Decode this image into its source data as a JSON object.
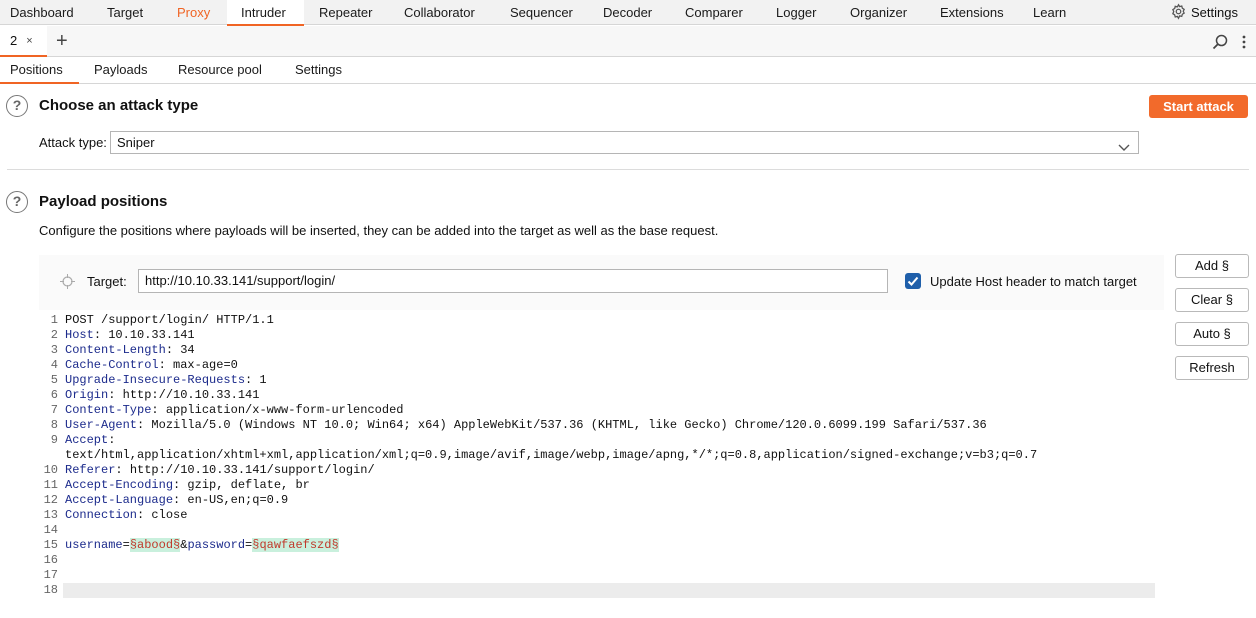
{
  "top_nav": {
    "tabs": [
      "Dashboard",
      "Target",
      "Proxy",
      "Intruder",
      "Repeater",
      "Collaborator",
      "Sequencer",
      "Decoder",
      "Comparer",
      "Logger",
      "Organizer",
      "Extensions",
      "Learn"
    ],
    "active_tab": "Intruder",
    "settings_label": "Settings"
  },
  "instance_tabs": {
    "tab_label": "2",
    "close_glyph": "×",
    "add_glyph": "+"
  },
  "sub_tabs": {
    "tabs": [
      "Positions",
      "Payloads",
      "Resource pool",
      "Settings"
    ],
    "active_tab": "Positions"
  },
  "attack_type_section": {
    "title": "Choose an attack type",
    "start_button": "Start attack",
    "attack_type_label": "Attack type:",
    "attack_type_value": "Sniper"
  },
  "payload_positions": {
    "title": "Payload positions",
    "description": "Configure the positions where payloads will be inserted, they can be added into the target as well as the base request.",
    "target_label": "Target:",
    "target_value": "http://10.10.33.141/support/login/",
    "update_host_label": "Update Host header to match target",
    "update_host_checked": true,
    "buttons": {
      "add": "Add §",
      "clear": "Clear §",
      "auto": "Auto §",
      "refresh": "Refresh"
    }
  },
  "request": {
    "line1": "POST /support/login/ HTTP/1.1",
    "headers": [
      {
        "num": "2",
        "key": "Host",
        "value": " 10.10.33.141"
      },
      {
        "num": "3",
        "key": "Content-Length",
        "value": " 34"
      },
      {
        "num": "4",
        "key": "Cache-Control",
        "value": " max-age=0"
      },
      {
        "num": "5",
        "key": "Upgrade-Insecure-Requests",
        "value": " 1"
      },
      {
        "num": "6",
        "key": "Origin",
        "value": " http://10.10.33.141"
      },
      {
        "num": "7",
        "key": "Content-Type",
        "value": " application/x-www-form-urlencoded"
      },
      {
        "num": "8",
        "key": "User-Agent",
        "value": " Mozilla/5.0 (Windows NT 10.0; Win64; x64) AppleWebKit/537.36 (KHTML, like Gecko) Chrome/120.0.6099.199 Safari/537.36"
      },
      {
        "num": "9",
        "key": "Accept",
        "value": ""
      }
    ],
    "accept_wrap": "text/html,application/xhtml+xml,application/xml;q=0.9,image/avif,image/webp,image/apng,*/*;q=0.8,application/signed-exchange;v=b3;q=0.7",
    "headers2": [
      {
        "num": "10",
        "key": "Referer",
        "value": " http://10.10.33.141/support/login/"
      },
      {
        "num": "11",
        "key": "Accept-Encoding",
        "value": " gzip, deflate, br"
      },
      {
        "num": "12",
        "key": "Accept-Language",
        "value": " en-US,en;q=0.9"
      },
      {
        "num": "13",
        "key": "Connection",
        "value": " close"
      }
    ],
    "body": {
      "p1_key": "username",
      "eq": "=",
      "p1_marker": "§abood§",
      "amp": "&",
      "p2_key": "password",
      "p2_marker": "§qawfaefszd§"
    },
    "line_numbers": [
      "1",
      "2",
      "3",
      "4",
      "5",
      "6",
      "7",
      "8",
      "9",
      "10",
      "11",
      "12",
      "13",
      "14",
      "15",
      "16",
      "17",
      "18"
    ]
  }
}
